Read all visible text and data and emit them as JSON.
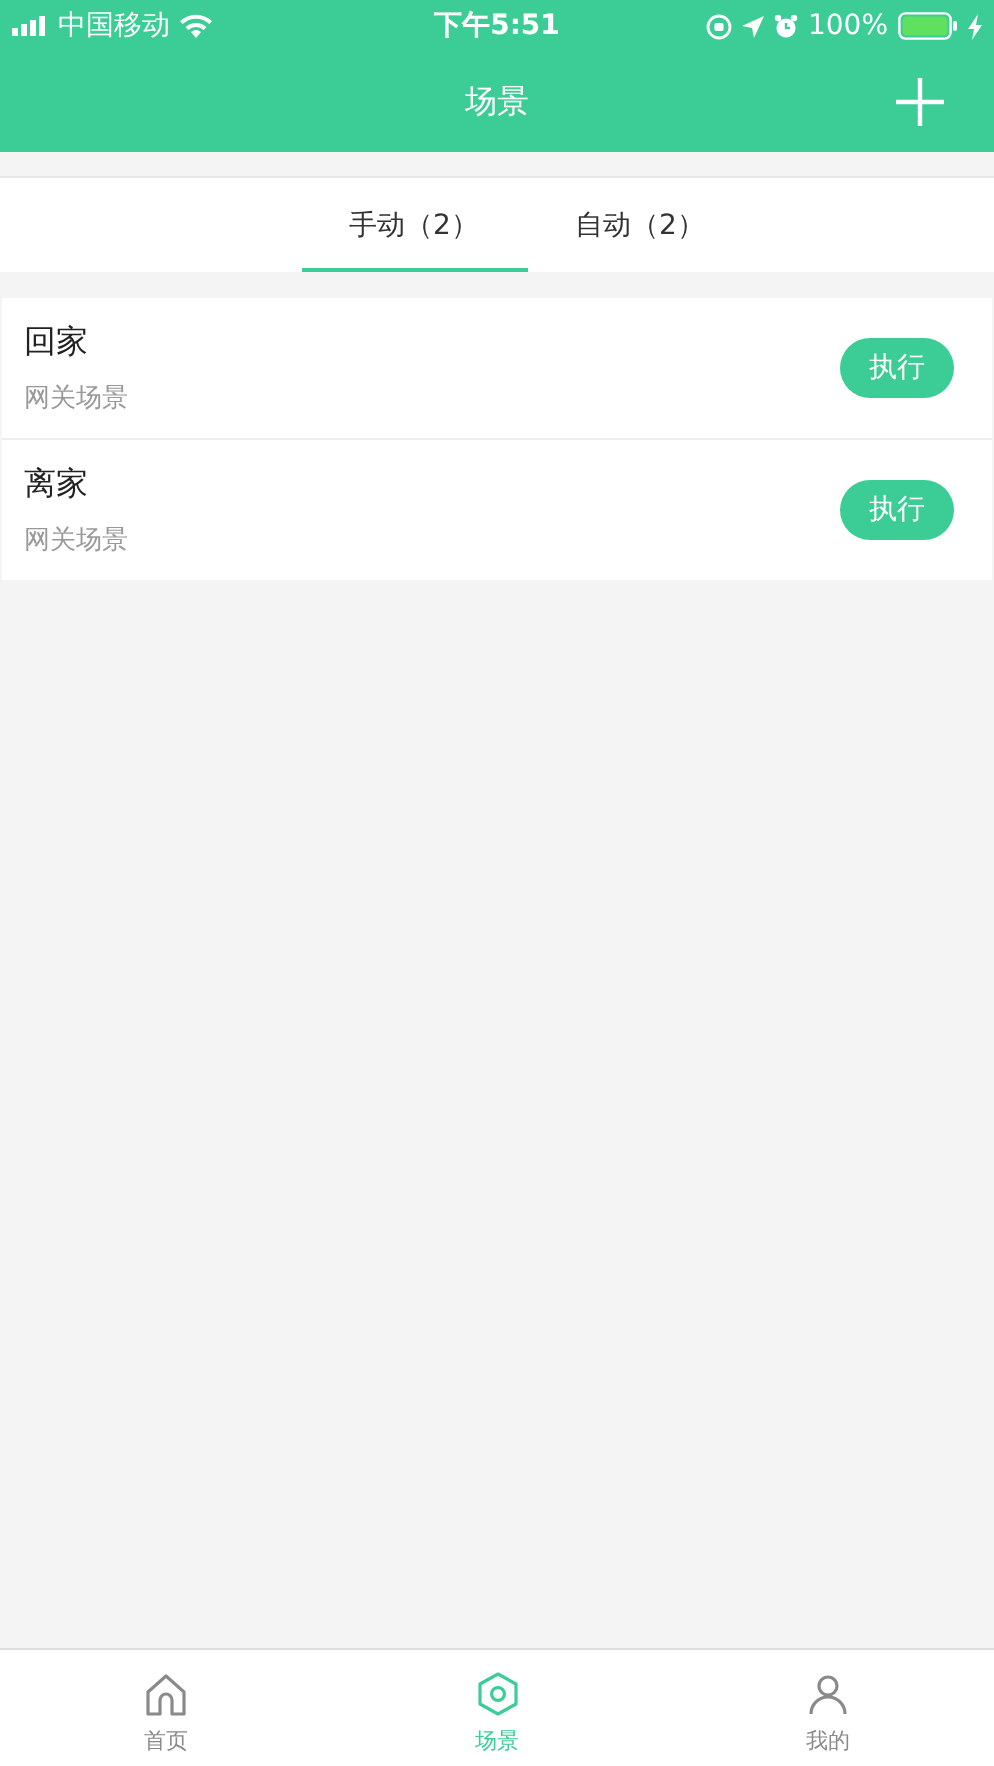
{
  "status_bar": {
    "carrier": "中国移动",
    "time": "下午5:51",
    "battery": "100%"
  },
  "nav_bar": {
    "title": "场景"
  },
  "tabs": [
    {
      "label": "手动（2）",
      "selected": true
    },
    {
      "label": "自动（2）",
      "selected": false
    }
  ],
  "scenes": [
    {
      "name": "回家",
      "subtitle": "网关场景",
      "action": "执行"
    },
    {
      "name": "离家",
      "subtitle": "网关场景",
      "action": "执行"
    }
  ],
  "tab_bar": [
    {
      "label": "首页",
      "selected": false
    },
    {
      "label": "场景",
      "selected": true
    },
    {
      "label": "我的",
      "selected": false
    }
  ]
}
